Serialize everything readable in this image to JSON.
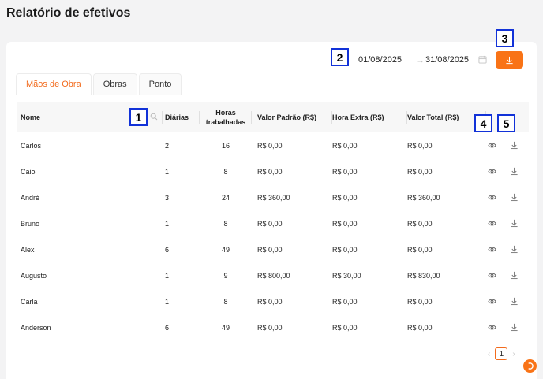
{
  "page": {
    "title": "Relatório de efetivos"
  },
  "filters": {
    "date_start": "01/08/2025",
    "date_end": "31/08/2025",
    "arrow": "→"
  },
  "tabs": [
    {
      "label": "Mãos de Obra",
      "active": true
    },
    {
      "label": "Obras",
      "active": false
    },
    {
      "label": "Ponto",
      "active": false
    }
  ],
  "table": {
    "columns": {
      "name": "Nome",
      "days": "Diárias",
      "hours_line1": "Horas",
      "hours_line2": "trabalhadas",
      "standard": "Valor Padrão (R$)",
      "overtime": "Hora Extra (R$)",
      "total": "Valor Total (R$)"
    },
    "rows": [
      {
        "name": "Carlos",
        "days": "2",
        "hours": "16",
        "standard": "R$ 0,00",
        "overtime": "R$ 0,00",
        "total": "R$ 0,00"
      },
      {
        "name": "Caio",
        "days": "1",
        "hours": "8",
        "standard": "R$ 0,00",
        "overtime": "R$ 0,00",
        "total": "R$ 0,00"
      },
      {
        "name": "André",
        "days": "3",
        "hours": "24",
        "standard": "R$ 360,00",
        "overtime": "R$ 0,00",
        "total": "R$ 360,00"
      },
      {
        "name": "Bruno",
        "days": "1",
        "hours": "8",
        "standard": "R$ 0,00",
        "overtime": "R$ 0,00",
        "total": "R$ 0,00"
      },
      {
        "name": "Alex",
        "days": "6",
        "hours": "49",
        "standard": "R$ 0,00",
        "overtime": "R$ 0,00",
        "total": "R$ 0,00"
      },
      {
        "name": "Augusto",
        "days": "1",
        "hours": "9",
        "standard": "R$ 800,00",
        "overtime": "R$ 30,00",
        "total": "R$ 830,00"
      },
      {
        "name": "Carla",
        "days": "1",
        "hours": "8",
        "standard": "R$ 0,00",
        "overtime": "R$ 0,00",
        "total": "R$ 0,00"
      },
      {
        "name": "Anderson",
        "days": "6",
        "hours": "49",
        "standard": "R$ 0,00",
        "overtime": "R$ 0,00",
        "total": "R$ 0,00"
      }
    ]
  },
  "pagination": {
    "prev": "‹",
    "current": "1",
    "next": "›"
  },
  "annotations": [
    "1",
    "2",
    "3",
    "4",
    "5"
  ],
  "icons": {
    "search": "search-icon",
    "calendar": "calendar-icon",
    "download": "download-icon",
    "view": "eye-icon",
    "help": "help-icon"
  },
  "colors": {
    "accent": "#f97316",
    "tab_active": "#f26b1d",
    "marker_border": "#1232d8"
  }
}
